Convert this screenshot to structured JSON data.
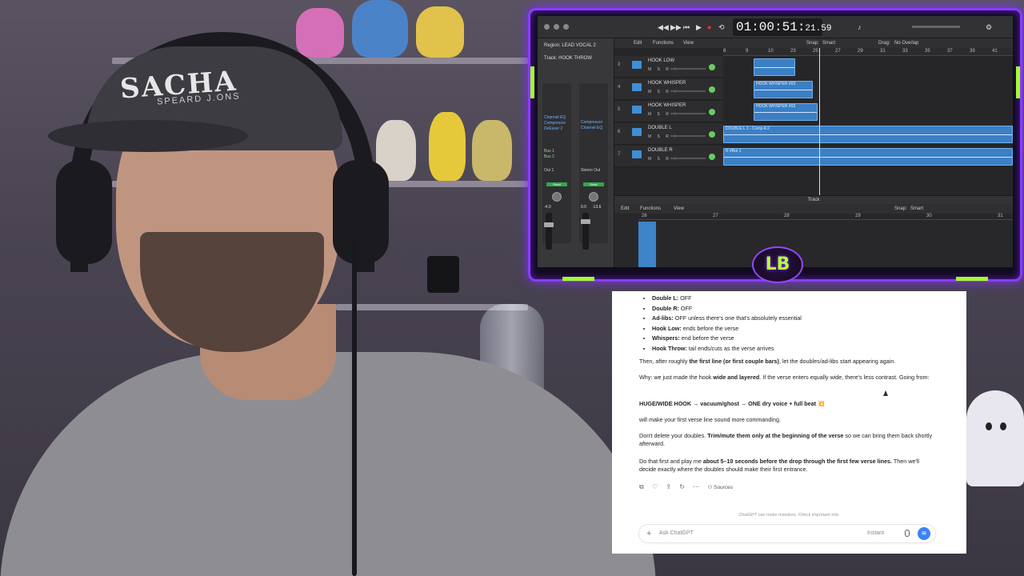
{
  "daw": {
    "timecode_main": "01:00:51:",
    "timecode_frames": "21.59",
    "region_label": "Region: LEAD VOCAL 2",
    "track_label": "Track: HOOK THROW",
    "toolbar": [
      "Edit",
      "Functions",
      "View"
    ],
    "snap_label": "Snap:",
    "snap_value": "Smart",
    "drag_label": "Drag:",
    "drag_value": "No Overlap",
    "ruler": [
      "8",
      "9",
      "10",
      "23",
      "25",
      "27",
      "29",
      "31",
      "33",
      "35",
      "37",
      "39",
      "41"
    ],
    "tracks": [
      {
        "num": "3",
        "name": "HOOK LOW"
      },
      {
        "num": "4",
        "name": "HOOK WHISPER"
      },
      {
        "num": "5",
        "name": "HOOK WHISPER"
      },
      {
        "num": "6",
        "name": "DOUBLE L"
      },
      {
        "num": "7",
        "name": "DOUBLE R"
      }
    ],
    "msr": "M S R I",
    "regions": [
      {
        "label": "",
        "track": 0
      },
      {
        "label": "HOOK WHISPER #03",
        "track": 1
      },
      {
        "label": "HOOK WHISPER #03",
        "track": 2
      },
      {
        "label": "DOUBLE L 1 - Comp A 2",
        "track": 3
      },
      {
        "label": "R #Bot 1",
        "track": 4
      }
    ],
    "plugins_a": [
      "Channel EQ",
      "Compressor",
      "DeEsser 2"
    ],
    "plugins_b": [
      "Compressor",
      "Channel EQ"
    ],
    "bus_labels": [
      "Bus 1",
      "Bus 2"
    ],
    "out_labels": [
      "Out 1",
      "Stereo Out"
    ],
    "read_label": "Read",
    "vol_a": "-4.0",
    "vol_b": "0.0",
    "vol_c": "-13.6",
    "editor_title": "Track",
    "editor_toolbar": [
      "Edit",
      "Functions",
      "View"
    ],
    "editor_snap": "Snap:",
    "editor_snap_value": "Smart",
    "editor_ruler": [
      "26",
      "27",
      "28",
      "29",
      "30",
      "31"
    ]
  },
  "chat": {
    "bullets": [
      {
        "bold": "Double L:",
        "text": " OFF"
      },
      {
        "bold": "Double R:",
        "text": " OFF"
      },
      {
        "bold": "Ad-libs:",
        "text": " OFF unless there's one that's absolutely essential"
      },
      {
        "bold": "Hook Low:",
        "text": " ends before the verse"
      },
      {
        "bold": "Whispers:",
        "text": " end before the verse"
      },
      {
        "bold": "Hook Throw:",
        "text": " tail ends/cuts as the verse arrives"
      }
    ],
    "p1_a": "Then, after roughly ",
    "p1_b": "the first line (or first couple bars)",
    "p1_c": ", let the doubles/ad-libs start appearing again.",
    "p2_a": "Why: we just made the hook ",
    "p2_b": "wide and layered",
    "p2_c": ". If the verse enters equally wide, there's less contrast. Going from:",
    "p3": "HUGE/WIDE HOOK → vacuum/ghost → ONE dry voice + full beat 💥",
    "p4": "will make your first verse line sound more commanding.",
    "p5_a": "Don't delete your doubles. ",
    "p5_b": "Trim/mute them only at the beginning of the verse",
    "p5_c": " so we can bring them back shortly afterward.",
    "p6_a": "Do that first and play me ",
    "p6_b": "about 5–10 seconds before the drop through the first few verse lines.",
    "p6_c": " Then we'll decide exactly where the doubles should make their first entrance.",
    "sources_label": "Sources",
    "disclaimer": "ChatGPT can make mistakes. Check important info.",
    "input_placeholder": "Ask ChatGPT",
    "mode_label": "Instant"
  },
  "webcam": {
    "cap_text": "SACHA",
    "cap_subtext": "SPEARD J.ONS"
  },
  "logo_text": "LB",
  "colors": {
    "neon_purple": "#8a3cff",
    "neon_green": "#a6ff2a",
    "region_blue": "#3b7fc4",
    "send_blue": "#3b82f6"
  }
}
